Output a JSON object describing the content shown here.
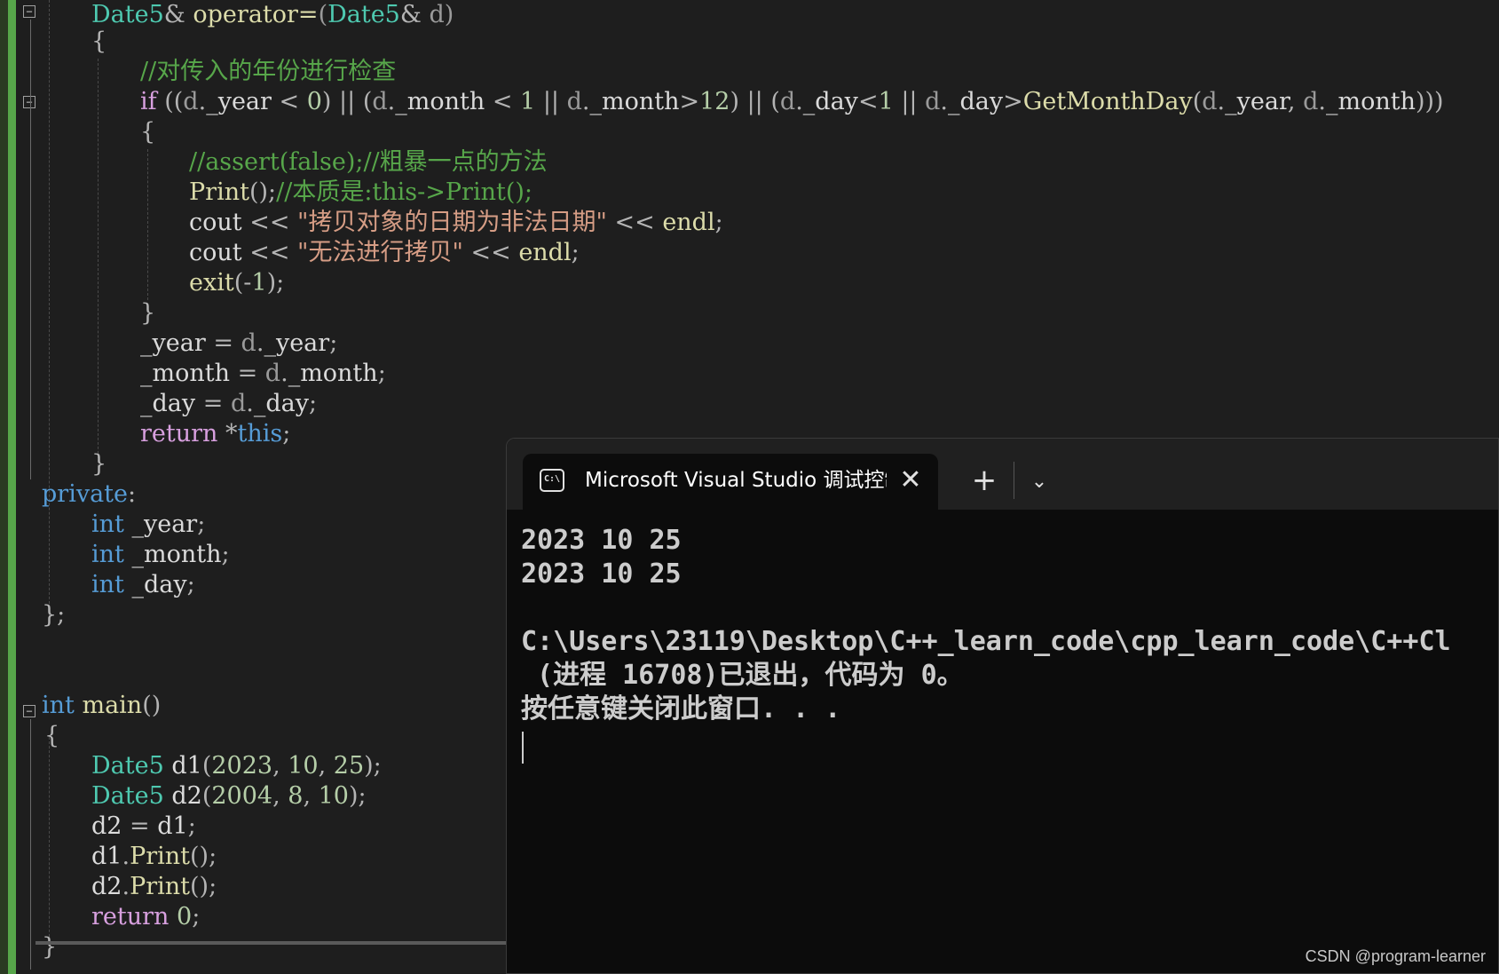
{
  "editor": {
    "lines": [
      {
        "t": [
          [
            "ty",
            "Date5"
          ],
          [
            "op",
            "& "
          ],
          [
            "fn",
            "operator="
          ],
          [
            "par",
            "("
          ],
          [
            "ty",
            "Date5"
          ],
          [
            "op",
            "& "
          ],
          [
            "par",
            "d"
          ],
          [
            "par",
            ")"
          ]
        ]
      },
      {
        "t": [
          [
            "op",
            "{"
          ]
        ]
      },
      {
        "t": [
          [
            "cm",
            "//对传入的年份进行检查"
          ]
        ]
      },
      {
        "t": [
          [
            "kw2",
            "if "
          ],
          [
            "op",
            "(("
          ],
          [
            "par",
            "d"
          ],
          [
            "op",
            "."
          ],
          [
            "mem",
            "_year "
          ],
          [
            "op",
            "< "
          ],
          [
            "num",
            "0"
          ],
          [
            "op",
            ") || ("
          ],
          [
            "par",
            "d"
          ],
          [
            "op",
            "."
          ],
          [
            "mem",
            "_month "
          ],
          [
            "op",
            "< "
          ],
          [
            "num",
            "1 "
          ],
          [
            "op",
            "|| "
          ],
          [
            "par",
            "d"
          ],
          [
            "op",
            "."
          ],
          [
            "mem",
            "_month"
          ],
          [
            "op",
            ">"
          ],
          [
            "num",
            "12"
          ],
          [
            "op",
            ") || ("
          ],
          [
            "par",
            "d"
          ],
          [
            "op",
            "."
          ],
          [
            "mem",
            "_day"
          ],
          [
            "op",
            "<"
          ],
          [
            "num",
            "1 "
          ],
          [
            "op",
            "|| "
          ],
          [
            "par",
            "d"
          ],
          [
            "op",
            "."
          ],
          [
            "mem",
            "_day"
          ],
          [
            "op",
            ">"
          ],
          [
            "fn",
            "GetMonthDay"
          ],
          [
            "op",
            "("
          ],
          [
            "par",
            "d"
          ],
          [
            "op",
            "."
          ],
          [
            "mem",
            "_year"
          ],
          [
            "op",
            ", "
          ],
          [
            "par",
            "d"
          ],
          [
            "op",
            "."
          ],
          [
            "mem",
            "_month"
          ],
          [
            "op",
            ")))"
          ]
        ]
      },
      {
        "t": [
          [
            "op",
            "{"
          ]
        ]
      },
      {
        "t": [
          [
            "cm",
            "//assert(false);//粗暴一点的方法"
          ]
        ]
      },
      {
        "t": [
          [
            "fn",
            "Print"
          ],
          [
            "op",
            "();"
          ],
          [
            "cm",
            "//本质是:this->Print();"
          ]
        ]
      },
      {
        "t": [
          [
            "var",
            "cout "
          ],
          [
            "op",
            "<< "
          ],
          [
            "str",
            "\"拷贝对象的日期为非法日期\" "
          ],
          [
            "op",
            "<< "
          ],
          [
            "fn",
            "endl"
          ],
          [
            "op",
            ";"
          ]
        ]
      },
      {
        "t": [
          [
            "var",
            "cout "
          ],
          [
            "op",
            "<< "
          ],
          [
            "str",
            "\"无法进行拷贝\" "
          ],
          [
            "op",
            "<< "
          ],
          [
            "fn",
            "endl"
          ],
          [
            "op",
            ";"
          ]
        ]
      },
      {
        "t": [
          [
            "fn",
            "exit"
          ],
          [
            "op",
            "(-"
          ],
          [
            "num",
            "1"
          ],
          [
            "op",
            ");"
          ]
        ]
      },
      {
        "t": [
          [
            "op",
            "}"
          ]
        ]
      },
      {
        "t": [
          [
            "mem",
            "_year "
          ],
          [
            "op",
            "= "
          ],
          [
            "par",
            "d"
          ],
          [
            "op",
            "."
          ],
          [
            "mem",
            "_year"
          ],
          [
            "op",
            ";"
          ]
        ]
      },
      {
        "t": [
          [
            "mem",
            "_month "
          ],
          [
            "op",
            "= "
          ],
          [
            "par",
            "d"
          ],
          [
            "op",
            "."
          ],
          [
            "mem",
            "_month"
          ],
          [
            "op",
            ";"
          ]
        ]
      },
      {
        "t": [
          [
            "mem",
            "_day "
          ],
          [
            "op",
            "= "
          ],
          [
            "par",
            "d"
          ],
          [
            "op",
            "."
          ],
          [
            "mem",
            "_day"
          ],
          [
            "op",
            ";"
          ]
        ]
      },
      {
        "t": [
          [
            "kw2",
            "return "
          ],
          [
            "op",
            "*"
          ],
          [
            "kw",
            "this"
          ],
          [
            "op",
            ";"
          ]
        ]
      },
      {
        "t": [
          [
            "op",
            "}"
          ]
        ]
      },
      {
        "t": [
          [
            "kw",
            "private"
          ],
          [
            "op",
            ":"
          ]
        ]
      },
      {
        "t": [
          [
            "kw",
            "int "
          ],
          [
            "mem",
            "_year"
          ],
          [
            "op",
            ";"
          ]
        ]
      },
      {
        "t": [
          [
            "kw",
            "int "
          ],
          [
            "mem",
            "_month"
          ],
          [
            "op",
            ";"
          ]
        ]
      },
      {
        "t": [
          [
            "kw",
            "int "
          ],
          [
            "mem",
            "_day"
          ],
          [
            "op",
            ";"
          ]
        ]
      },
      {
        "t": [
          [
            "op",
            "};"
          ]
        ]
      },
      {
        "t": []
      },
      {
        "t": []
      },
      {
        "t": [
          [
            "kw",
            "int "
          ],
          [
            "fn",
            "main"
          ],
          [
            "op",
            "()"
          ]
        ]
      },
      {
        "t": [
          [
            "op",
            "{"
          ]
        ]
      },
      {
        "t": [
          [
            "ty",
            "Date5 "
          ],
          [
            "var",
            "d1"
          ],
          [
            "op",
            "("
          ],
          [
            "num",
            "2023"
          ],
          [
            "op",
            ", "
          ],
          [
            "num",
            "10"
          ],
          [
            "op",
            ", "
          ],
          [
            "num",
            "25"
          ],
          [
            "op",
            ");"
          ]
        ]
      },
      {
        "t": [
          [
            "ty",
            "Date5 "
          ],
          [
            "var",
            "d2"
          ],
          [
            "op",
            "("
          ],
          [
            "num",
            "2004"
          ],
          [
            "op",
            ", "
          ],
          [
            "num",
            "8"
          ],
          [
            "op",
            ", "
          ],
          [
            "num",
            "10"
          ],
          [
            "op",
            ");"
          ]
        ]
      },
      {
        "t": [
          [
            "var",
            "d2 "
          ],
          [
            "op",
            "= "
          ],
          [
            "var",
            "d1"
          ],
          [
            "op",
            ";"
          ]
        ]
      },
      {
        "t": [
          [
            "var",
            "d1"
          ],
          [
            "op",
            "."
          ],
          [
            "fn",
            "Print"
          ],
          [
            "op",
            "();"
          ]
        ]
      },
      {
        "t": [
          [
            "var",
            "d2"
          ],
          [
            "op",
            "."
          ],
          [
            "fn",
            "Print"
          ],
          [
            "op",
            "();"
          ]
        ]
      },
      {
        "t": [
          [
            "kw2",
            "return "
          ],
          [
            "num",
            "0"
          ],
          [
            "op",
            ";"
          ]
        ]
      },
      {
        "t": [
          [
            "op",
            "}"
          ]
        ]
      }
    ]
  },
  "console": {
    "tab_title": "Microsoft Visual Studio 调试控制台",
    "icon_text": "C:\\",
    "close_glyph": "✕",
    "new_tab_glyph": "+",
    "dropdown_glyph": "⌄",
    "output": [
      "2023 10 25",
      "2023 10 25",
      "",
      "C:\\Users\\23119\\Desktop\\C++_learn_code\\cpp_learn_code\\C++Cl",
      " (进程 16708)已退出，代码为 0。",
      "按任意键关闭此窗口. . ."
    ]
  },
  "watermark": "CSDN @program-learner"
}
